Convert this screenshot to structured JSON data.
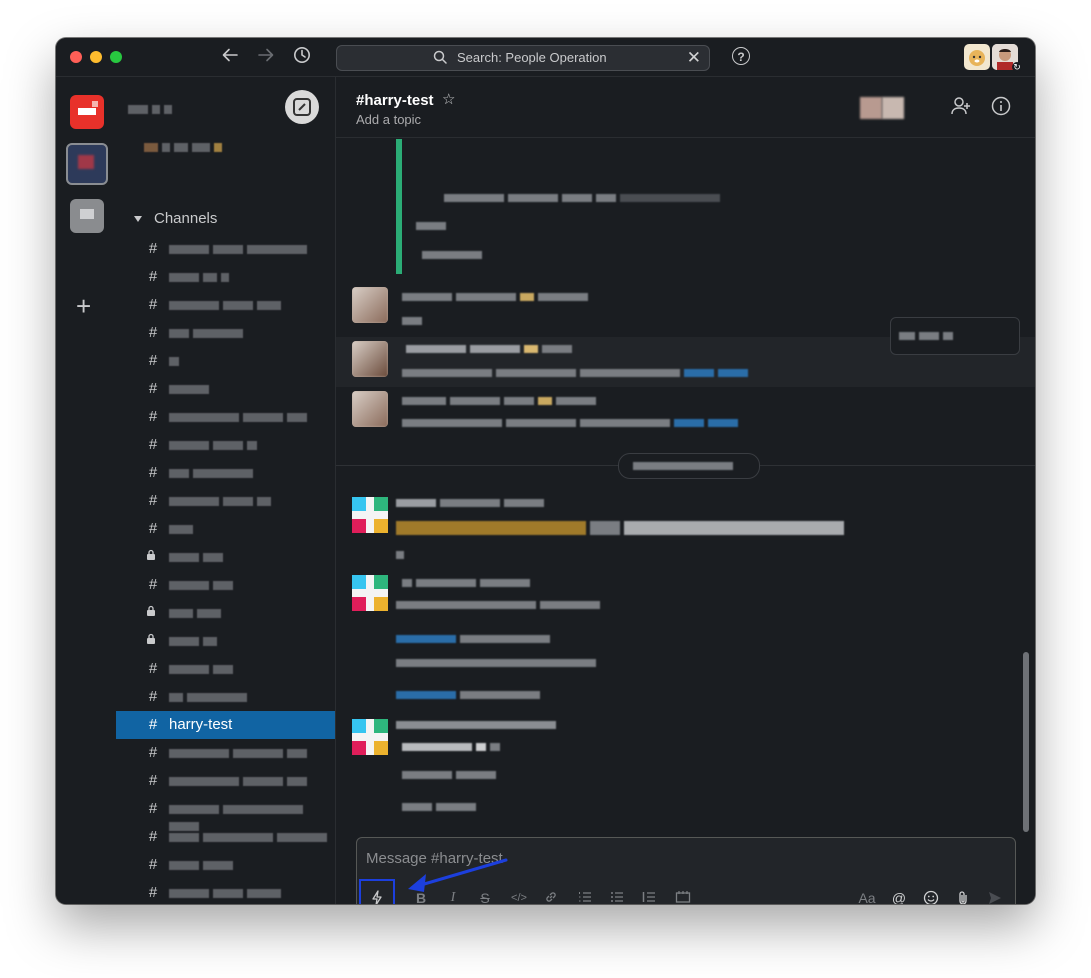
{
  "search": {
    "placeholder": "Search: People Operation"
  },
  "sidebar": {
    "section_title": "Channels",
    "channels": [
      {
        "label": "",
        "private": false
      },
      {
        "label": "",
        "private": false
      },
      {
        "label": "",
        "private": false
      },
      {
        "label": "",
        "private": false
      },
      {
        "label": "",
        "private": false
      },
      {
        "label": "",
        "private": false
      },
      {
        "label": "",
        "private": false
      },
      {
        "label": "",
        "private": false
      },
      {
        "label": "",
        "private": false
      },
      {
        "label": "",
        "private": false
      },
      {
        "label": "",
        "private": false
      },
      {
        "label": "",
        "private": true
      },
      {
        "label": "",
        "private": false
      },
      {
        "label": "",
        "private": true
      },
      {
        "label": "",
        "private": true
      },
      {
        "label": "",
        "private": false
      },
      {
        "label": "",
        "private": false
      },
      {
        "label": "harry-test",
        "private": false,
        "active": true
      },
      {
        "label": "",
        "private": false
      },
      {
        "label": "",
        "private": false
      },
      {
        "label": "",
        "private": false
      },
      {
        "label": "",
        "private": false
      },
      {
        "label": "",
        "private": false
      },
      {
        "label": "",
        "private": false
      }
    ]
  },
  "channel": {
    "title": "#harry-test",
    "topic": "Add a topic"
  },
  "composer": {
    "placeholder": "Message #harry-test",
    "tools": {
      "shortcuts": "shortcuts-lightning-icon",
      "bold": "B",
      "italic": "I",
      "strike": "S",
      "code": "</>",
      "link": "link-icon",
      "ordered_list": "ordered-list-icon",
      "bullet_list": "bullet-list-icon",
      "blockquote": "blockquote-icon",
      "code_block": "code-block-icon",
      "format": "Aa",
      "mention": "@",
      "emoji": "emoji-icon",
      "attach": "paperclip-icon",
      "send": "send-icon"
    }
  },
  "colors": {
    "active_channel": "#1164a3",
    "annotation": "#1c3fdd",
    "background": "#1a1d21"
  }
}
